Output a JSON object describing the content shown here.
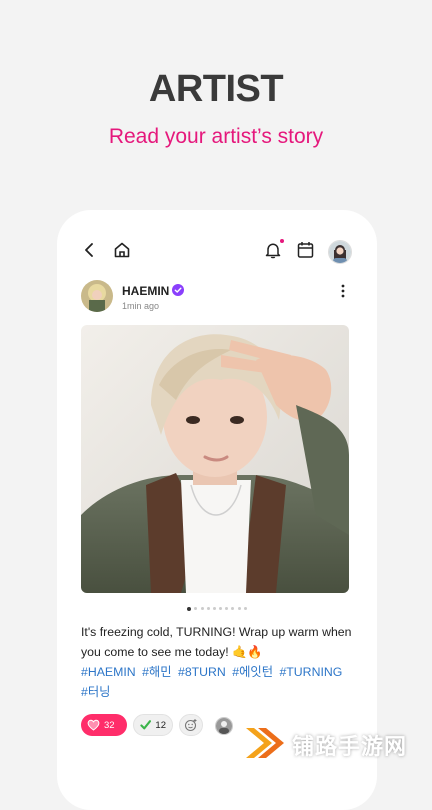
{
  "promo": {
    "title": "ARTIST",
    "subtitle": "Read your artist’s story"
  },
  "topbar": {
    "icons": [
      "back-icon",
      "home-icon",
      "bell-icon",
      "calendar-icon",
      "profile-avatar"
    ],
    "has_notification": true
  },
  "post": {
    "author": "HAEMIN",
    "verified": true,
    "time": "1min ago",
    "image_count": 10,
    "active_image": 1,
    "caption": "It's freezing cold, TURNING! Wrap up warm when you come to see me today! 🤙🔥",
    "hashtags": [
      "#HAEMIN",
      "#해민",
      "#8TURN",
      "#에잇턴",
      "#TURNING",
      "#터닝"
    ],
    "reactions": {
      "heart_count": "32",
      "check_count": "12"
    }
  },
  "watermark": {
    "text": "铺路手游网"
  },
  "colors": {
    "accent": "#e5187c",
    "heart": "#ff2d6a",
    "hashtag": "#2d76c8",
    "verified": "#8a3ffc"
  }
}
